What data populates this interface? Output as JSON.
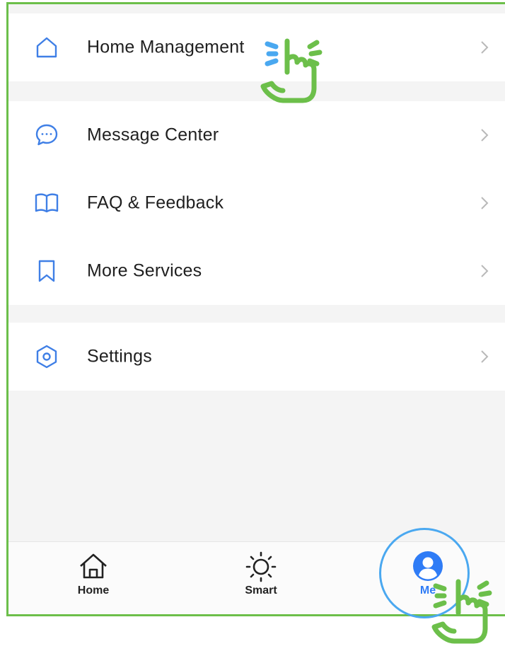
{
  "menu": {
    "group1": [
      {
        "label": "Home Management",
        "icon": "home-outline-icon"
      }
    ],
    "group2": [
      {
        "label": "Message Center",
        "icon": "chat-bubble-icon"
      },
      {
        "label": "FAQ & Feedback",
        "icon": "open-book-icon"
      },
      {
        "label": "More Services",
        "icon": "bookmark-icon"
      }
    ],
    "group3": [
      {
        "label": "Settings",
        "icon": "hexagon-settings-icon"
      }
    ]
  },
  "tabbar": {
    "tabs": [
      {
        "label": "Home",
        "icon": "home-tab-icon"
      },
      {
        "label": "Smart",
        "icon": "sun-icon"
      },
      {
        "label": "Me",
        "icon": "profile-icon",
        "active": true
      }
    ]
  },
  "colors": {
    "accent": "#2f7cf6",
    "icon_blue": "#3f7fe6",
    "annotation_green": "#6cbf4a",
    "highlight_ring": "#4aa8f0"
  }
}
